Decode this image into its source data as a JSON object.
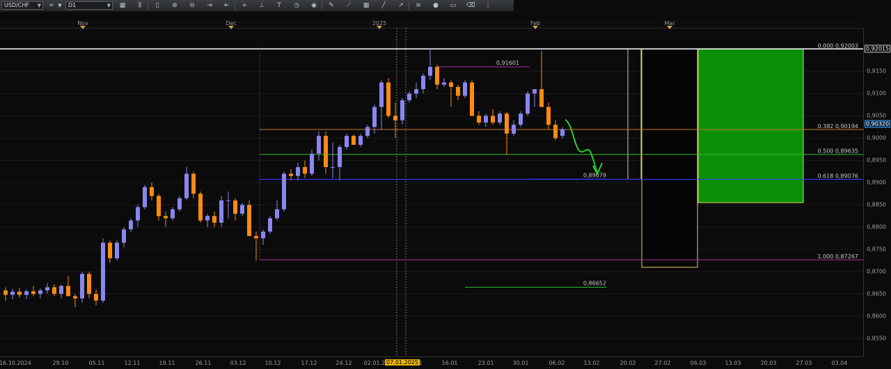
{
  "toolbar": {
    "symbol": "USD/CHF",
    "timeframe": "D1",
    "icons": [
      "chart-type-icon",
      "bar-chart-icon",
      "candle-chart-icon",
      "zoom-in-icon",
      "zoom-out-icon",
      "auto-scroll-icon",
      "chart-shift-icon",
      "crosshair-icon",
      "vertical-line-icon",
      "text-icon",
      "period-icon",
      "color-icon",
      "pencil-icon",
      "trend-icon",
      "grid-icon",
      "line-icon",
      "arrow-icon",
      "fib-icon",
      "circle-icon",
      "rectangle-icon",
      "eraser-icon",
      "more-icon"
    ]
  },
  "months": [
    {
      "label": "Nov",
      "x": 119
    },
    {
      "label": "Dec",
      "x": 332
    },
    {
      "label": "2025",
      "x": 545
    },
    {
      "label": "Feb",
      "x": 769
    },
    {
      "label": "Mar",
      "x": 962
    }
  ],
  "price_axis": {
    "ticks": [
      "0,9150",
      "0,9100",
      "0,9050",
      "0,9000",
      "0,8950",
      "0,8900",
      "0,8850",
      "0,8800",
      "0,8750",
      "0,8700",
      "0,8650",
      "0,8600",
      "0,8550"
    ],
    "top_box": "0,92015",
    "current_price": "0,90320"
  },
  "date_axis": {
    "ticks": [
      "16.10.2024",
      "29.10",
      "05.11",
      "12.11",
      "19.11",
      "26.11",
      "03.12",
      "10.12",
      "17.12",
      "24.12",
      "02.01.2",
      "1",
      "16.01",
      "23.01",
      "30.01",
      "06.02",
      "13.02",
      "20.02",
      "27.02",
      "06.03",
      "13.03",
      "20.03",
      "27.03",
      "03.04"
    ],
    "highlight": "07.01.2025"
  },
  "fib_levels": [
    {
      "label": "0.000 0,92003",
      "color": "#ffffff"
    },
    {
      "label": "0.382 0,90194",
      "color": "#d07a2a"
    },
    {
      "label": "0.500 0,89635",
      "color": "#2fbf2f"
    },
    {
      "label": "0.618 0,89076",
      "color": "#3a3aff"
    },
    {
      "label": "1.000 0,87267",
      "color": "#b0309a"
    }
  ],
  "annotations": {
    "high_label": "0,91601",
    "fib_target": "0,89079",
    "low_target": "0,86652"
  },
  "colors": {
    "bull": "#8a86f0",
    "bear": "#ff8a10",
    "target_zone": "#0a8f0a",
    "box_outline": "#e0d070"
  },
  "chart_data": {
    "type": "candlestick",
    "symbol": "USD/CHF",
    "timeframe": "D1",
    "candles": [
      [
        0.8658,
        0.8665,
        0.8635,
        0.8648
      ],
      [
        0.8648,
        0.8662,
        0.8638,
        0.8655
      ],
      [
        0.8655,
        0.8664,
        0.8642,
        0.8648
      ],
      [
        0.8648,
        0.866,
        0.8638,
        0.8656
      ],
      [
        0.8656,
        0.8668,
        0.8645,
        0.865
      ],
      [
        0.865,
        0.8662,
        0.864,
        0.8658
      ],
      [
        0.8658,
        0.8675,
        0.865,
        0.8665
      ],
      [
        0.8665,
        0.8672,
        0.8645,
        0.865
      ],
      [
        0.865,
        0.867,
        0.864,
        0.8668
      ],
      [
        0.8668,
        0.869,
        0.8655,
        0.8645
      ],
      [
        0.8645,
        0.865,
        0.862,
        0.864
      ],
      [
        0.864,
        0.87,
        0.863,
        0.8695
      ],
      [
        0.8695,
        0.87,
        0.864,
        0.865
      ],
      [
        0.865,
        0.866,
        0.8625,
        0.8635
      ],
      [
        0.8635,
        0.8775,
        0.863,
        0.8765
      ],
      [
        0.8765,
        0.877,
        0.872,
        0.873
      ],
      [
        0.873,
        0.877,
        0.8725,
        0.8765
      ],
      [
        0.8765,
        0.88,
        0.8755,
        0.8795
      ],
      [
        0.8795,
        0.882,
        0.879,
        0.8815
      ],
      [
        0.8815,
        0.885,
        0.88,
        0.8845
      ],
      [
        0.8845,
        0.8895,
        0.884,
        0.889
      ],
      [
        0.889,
        0.89,
        0.886,
        0.887
      ],
      [
        0.887,
        0.8875,
        0.8815,
        0.8825
      ],
      [
        0.8825,
        0.8835,
        0.88,
        0.882
      ],
      [
        0.882,
        0.8845,
        0.8815,
        0.884
      ],
      [
        0.884,
        0.887,
        0.8835,
        0.8865
      ],
      [
        0.8865,
        0.8935,
        0.886,
        0.892
      ],
      [
        0.892,
        0.8925,
        0.8865,
        0.8875
      ],
      [
        0.8875,
        0.888,
        0.881,
        0.8815
      ],
      [
        0.8815,
        0.883,
        0.88,
        0.8825
      ],
      [
        0.8825,
        0.8835,
        0.88,
        0.881
      ],
      [
        0.881,
        0.887,
        0.88,
        0.886
      ],
      [
        0.886,
        0.888,
        0.882,
        0.886
      ],
      [
        0.886,
        0.8865,
        0.8815,
        0.883
      ],
      [
        0.883,
        0.8855,
        0.8825,
        0.885
      ],
      [
        0.885,
        0.886,
        0.8785,
        0.878
      ],
      [
        0.878,
        0.879,
        0.8725,
        0.8775
      ],
      [
        0.8775,
        0.8795,
        0.876,
        0.879
      ],
      [
        0.879,
        0.8825,
        0.8785,
        0.882
      ],
      [
        0.882,
        0.886,
        0.8815,
        0.884
      ],
      [
        0.884,
        0.8925,
        0.8835,
        0.892
      ],
      [
        0.892,
        0.893,
        0.8905,
        0.8915
      ],
      [
        0.8915,
        0.8945,
        0.8905,
        0.8935
      ],
      [
        0.8935,
        0.895,
        0.891,
        0.892
      ],
      [
        0.892,
        0.8975,
        0.8915,
        0.8965
      ],
      [
        0.8965,
        0.9015,
        0.895,
        0.9005
      ],
      [
        0.9005,
        0.9015,
        0.892,
        0.8935
      ],
      [
        0.8935,
        0.899,
        0.891,
        0.8935
      ],
      [
        0.8935,
        0.8985,
        0.8905,
        0.898
      ],
      [
        0.898,
        0.901,
        0.8975,
        0.9005
      ],
      [
        0.9005,
        0.9008,
        0.8985,
        0.8985
      ],
      [
        0.8985,
        0.901,
        0.898,
        0.9005
      ],
      [
        0.9005,
        0.903,
        0.9,
        0.9025
      ],
      [
        0.9025,
        0.9075,
        0.901,
        0.907
      ],
      [
        0.907,
        0.913,
        0.902,
        0.9125
      ],
      [
        0.9125,
        0.9135,
        0.9045,
        0.905
      ],
      [
        0.905,
        0.908,
        0.9,
        0.904
      ],
      [
        0.904,
        0.909,
        0.903,
        0.9085
      ],
      [
        0.9085,
        0.9105,
        0.908,
        0.91
      ],
      [
        0.91,
        0.9125,
        0.909,
        0.911
      ],
      [
        0.911,
        0.9145,
        0.91,
        0.914
      ],
      [
        0.914,
        0.92,
        0.913,
        0.916
      ],
      [
        0.916,
        0.9165,
        0.911,
        0.912
      ],
      [
        0.912,
        0.9135,
        0.9115,
        0.9125
      ],
      [
        0.9125,
        0.913,
        0.907,
        0.9115
      ],
      [
        0.9115,
        0.912,
        0.9085,
        0.9095
      ],
      [
        0.9095,
        0.913,
        0.909,
        0.9125
      ],
      [
        0.9125,
        0.913,
        0.905,
        0.905
      ],
      [
        0.905,
        0.906,
        0.903,
        0.9035
      ],
      [
        0.9035,
        0.9055,
        0.9025,
        0.905
      ],
      [
        0.905,
        0.9065,
        0.903,
        0.9035
      ],
      [
        0.9035,
        0.906,
        0.903,
        0.9055
      ],
      [
        0.9055,
        0.9058,
        0.8962,
        0.901
      ],
      [
        0.901,
        0.904,
        0.9005,
        0.903
      ],
      [
        0.903,
        0.906,
        0.9025,
        0.9055
      ],
      [
        0.9055,
        0.9105,
        0.905,
        0.91
      ],
      [
        0.91,
        0.911,
        0.907,
        0.911
      ],
      [
        0.911,
        0.9195,
        0.91,
        0.907
      ],
      [
        0.907,
        0.908,
        0.902,
        0.903
      ],
      [
        0.903,
        0.904,
        0.8995,
        0.9
      ],
      [
        0.9005,
        0.9025,
        0.9,
        0.902
      ]
    ],
    "fibonacci": [
      {
        "ratio": 0.0,
        "price": 0.92003
      },
      {
        "ratio": 0.382,
        "price": 0.90194
      },
      {
        "ratio": 0.5,
        "price": 0.89635
      },
      {
        "ratio": 0.618,
        "price": 0.89076
      },
      {
        "ratio": 1.0,
        "price": 0.87267
      }
    ],
    "levels": [
      {
        "label": "0,91601",
        "price": 0.91601,
        "color": "#b0309a"
      },
      {
        "label": "0,89079",
        "price": 0.89079,
        "color": "#3a3aff"
      },
      {
        "label": "0,86652",
        "price": 0.86652,
        "color": "#2fbf2f"
      }
    ],
    "zones": [
      {
        "name": "yellow-box-upper",
        "price_top": 0.92003,
        "price_bottom": 0.89076
      },
      {
        "name": "black-box",
        "price_top": 0.92003,
        "price_bottom": 0.871
      },
      {
        "name": "green-box",
        "price_top": 0.92003,
        "price_bottom": 0.8855
      }
    ],
    "ylim": [
      0.853,
      0.922
    ]
  }
}
